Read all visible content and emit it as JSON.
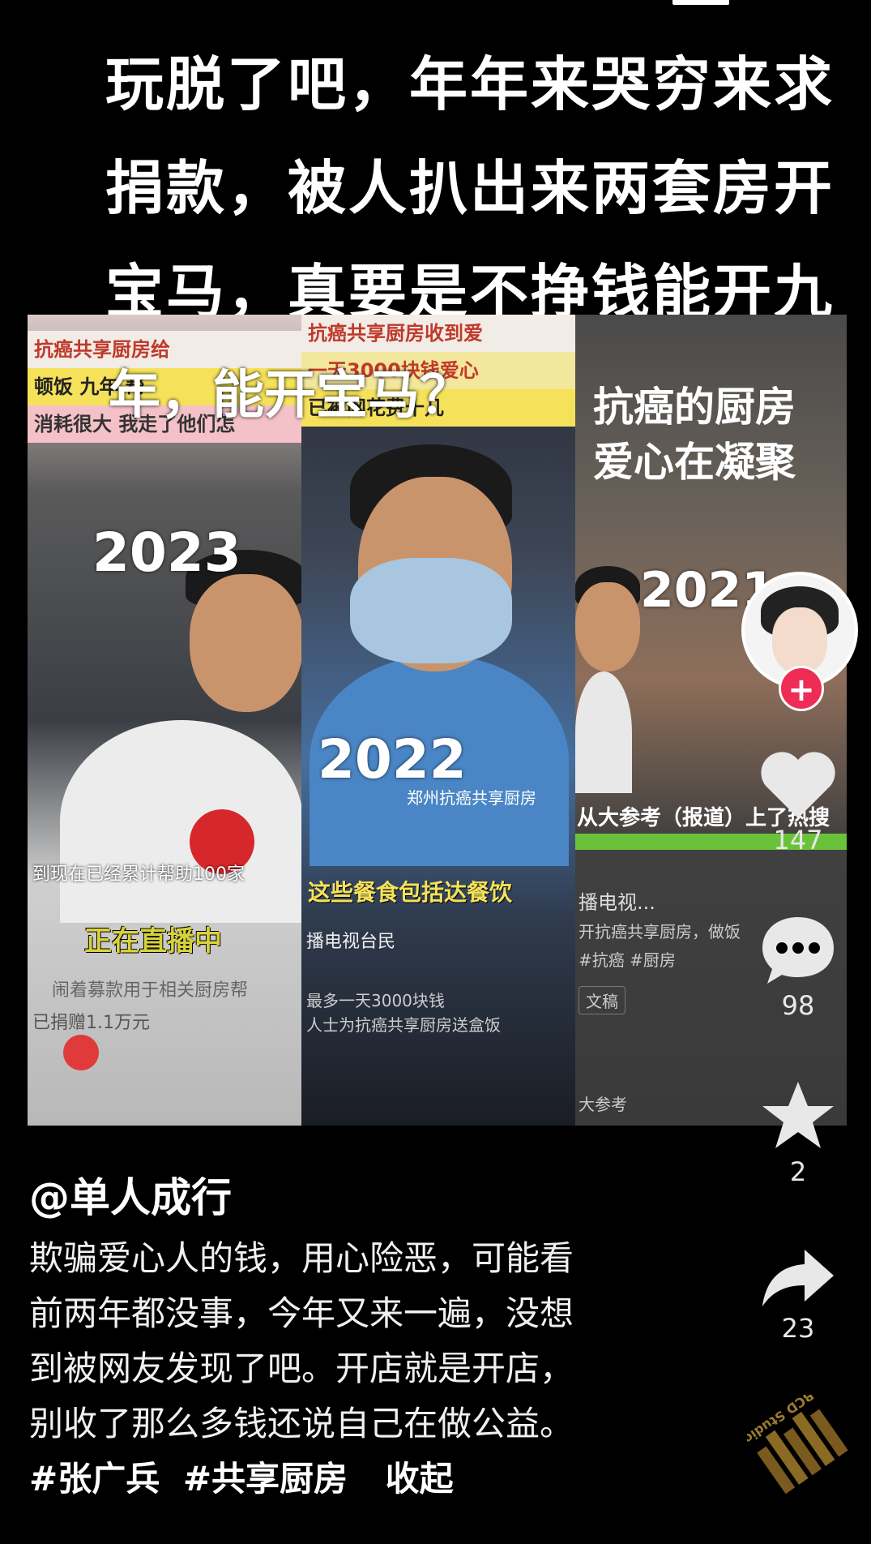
{
  "headline": {
    "lines": [
      "玩脱了吧，年年来哭穷来求",
      "捐款，被人扒出来两套房开",
      "宝马，真要是不挣钱能开九"
    ],
    "overlay_caption": "年，能开宝马？"
  },
  "collage": {
    "panel1": {
      "strips": [
        "抗癌共享厨房给",
        "顿饭 九年 帮",
        "消耗很大 我走了他们怎"
      ],
      "year": "2023",
      "caption": "到现在已经累计帮助100家",
      "live": "正在直播中",
      "sub1": "闹着募款用于相关厨房帮",
      "sub2": "已捐赠1.1万元"
    },
    "panel2": {
      "strips": [
        "抗癌共享厨房收到爱",
        "一天3000块钱爱心",
        "已被网花费十几"
      ],
      "year": "2022",
      "tag": "郑州抗癌共享厨房",
      "caption": "这些餐食包括达餐饮",
      "sub1": "播电视台民",
      "sub2": "最多一天3000块钱",
      "sub3": "人士为抗癌共享厨房送盒饭"
    },
    "panel3": {
      "title_lines": [
        "抗癌的厨房",
        "爱心在凝聚"
      ],
      "year": "2021",
      "caption": "从大参考（报道）上了热搜",
      "sub1": "播电视...",
      "sub2": "开抗癌共享厨房，做饭",
      "sub3": "#抗癌 #厨房",
      "sub4": "文稿",
      "sub5": "大参考"
    }
  },
  "sidebar": {
    "follow_symbol": "+",
    "likes": "147",
    "comments": "98",
    "favorites": "2",
    "shares": "23"
  },
  "post": {
    "author": "@单人成行",
    "description_lines": [
      "欺骗爱心人的钱，用心险恶，可能看",
      "前两年都没事，今年又来一遍，没想",
      "到被网友发现了吧。开店就是开店，",
      "别收了那么多钱还说自己在做公益。"
    ],
    "tags": [
      "#张广兵",
      "#共享厨房"
    ],
    "collapse_label": "收起"
  },
  "watermark": "BCD Studio",
  "colors": {
    "background": "#000000",
    "follow": "#ee2c55",
    "icon": "#e8e8e8"
  }
}
